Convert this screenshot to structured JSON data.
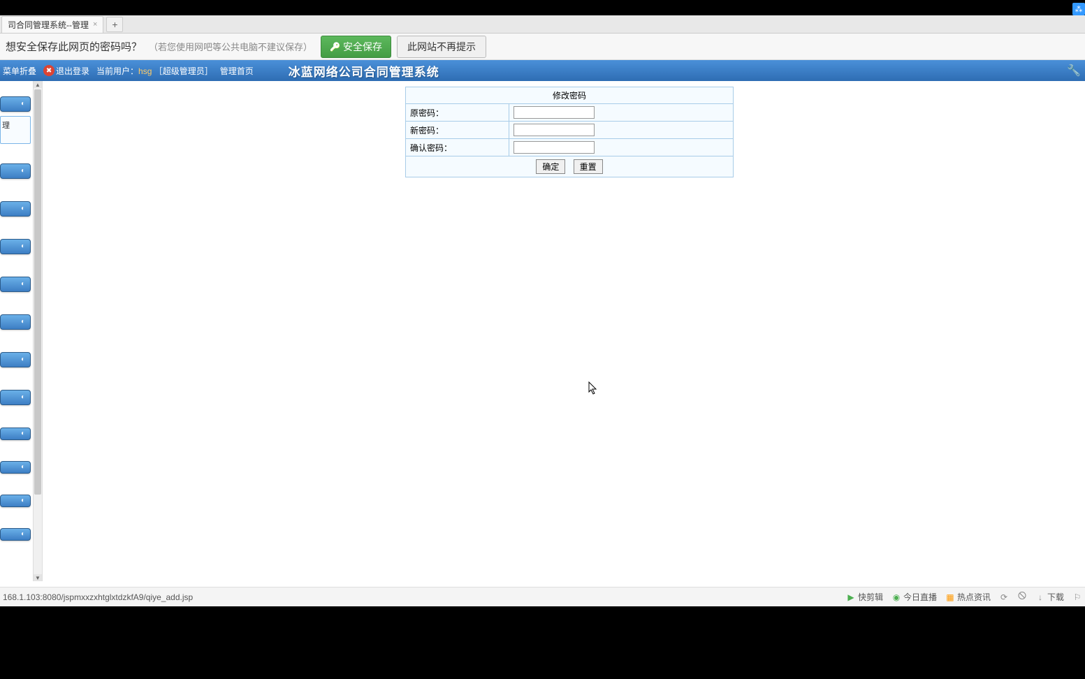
{
  "tab": {
    "title": "司合同管理系统--管理"
  },
  "password_bar": {
    "prompt": "想安全保存此网页的密码吗？",
    "hint": "（若您使用网吧等公共电脑不建议保存）",
    "save_btn": "安全保存",
    "no_remind_btn": "此网站不再提示"
  },
  "header": {
    "menu_toggle": "菜单折叠",
    "logout": "退出登录",
    "user_prefix": "当前用户：",
    "username": "hsg",
    "role": "［超级管理员］",
    "admin_home": "管理首页",
    "title": "冰蓝网络公司合同管理系统"
  },
  "sidebar": {
    "sub_label": "理"
  },
  "form": {
    "title": "修改密码",
    "old_pwd": "原密码：",
    "new_pwd": "新密码：",
    "confirm_pwd": "确认密码：",
    "ok": "确定",
    "reset": "重置"
  },
  "status": {
    "url": "168.1.103:8080/jspmxxzxhtglxtdzkfA9/qiye_add.jsp",
    "quick_cut": "快剪辑",
    "live": "今日直播",
    "news": "热点资讯",
    "download": "下载"
  }
}
